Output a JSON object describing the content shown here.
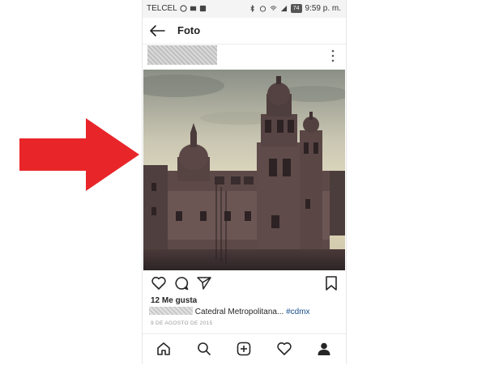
{
  "status_bar": {
    "carrier": "TELCEL",
    "battery": "74",
    "time": "9:59 p. m."
  },
  "header": {
    "title": "Foto"
  },
  "post": {
    "likes": "12 Me gusta",
    "caption_text": "Catedral Metropolitana...",
    "hashtag": "#cdmx",
    "date": "9 DE AGOSTO DE 2015"
  },
  "colors": {
    "arrow": "#e8262a",
    "hashtag": "#1b4f8f"
  },
  "icons": {
    "back": "back-arrow-icon",
    "more": "more-vertical-icon",
    "like": "heart-icon",
    "comment": "comment-icon",
    "share": "send-icon",
    "save": "bookmark-icon",
    "home": "home-icon",
    "search": "search-icon",
    "add": "add-post-icon",
    "activity": "heart-icon",
    "profile": "profile-icon"
  }
}
